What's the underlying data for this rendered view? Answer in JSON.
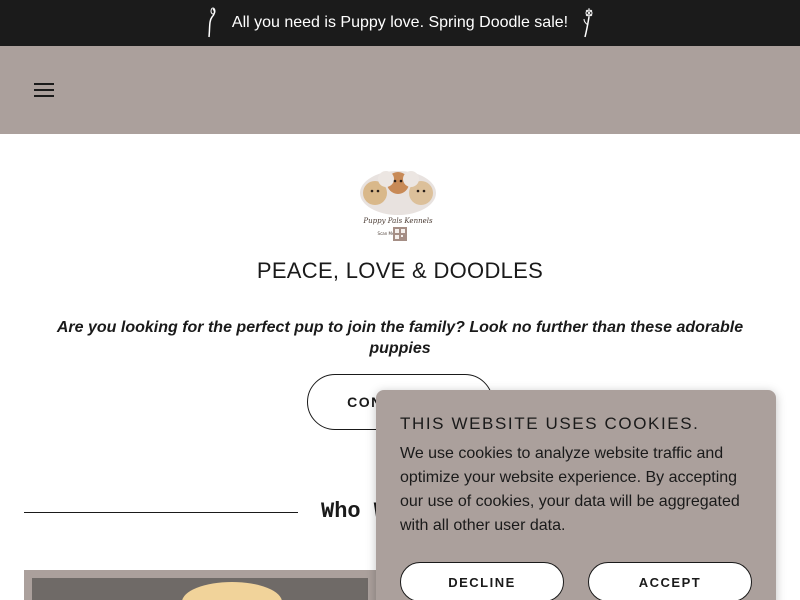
{
  "announcement": {
    "text": "All you need is Puppy love. Spring Doodle sale!",
    "left_icon": "flower-stem-icon",
    "right_icon": "flower-bloom-icon"
  },
  "header": {
    "menu_icon": "hamburger-menu-icon",
    "background": "#aba09c"
  },
  "logo": {
    "name": "puppy-logo-with-qr",
    "lettering": "Puppy Pals Kennels",
    "scan_label": "Scan Me"
  },
  "hero": {
    "brand": "PEACE, LOVE & DOODLES",
    "tagline": "Are you looking for the perfect pup to join the family? Look no further than these adorable puppies",
    "cta_label": "CONTACT US"
  },
  "section": {
    "title": "Who We Are"
  },
  "cookie_banner": {
    "title": "THIS WEBSITE USES COOKIES.",
    "body": "We use cookies to analyze website traffic and optimize your website experience. By accepting our use of cookies, your data will be aggregated with all other user data.",
    "decline_label": "DECLINE",
    "accept_label": "ACCEPT"
  },
  "colors": {
    "announcement_bg": "#1b1b1b",
    "accent": "#aba09c",
    "text": "#1a1a1a"
  }
}
